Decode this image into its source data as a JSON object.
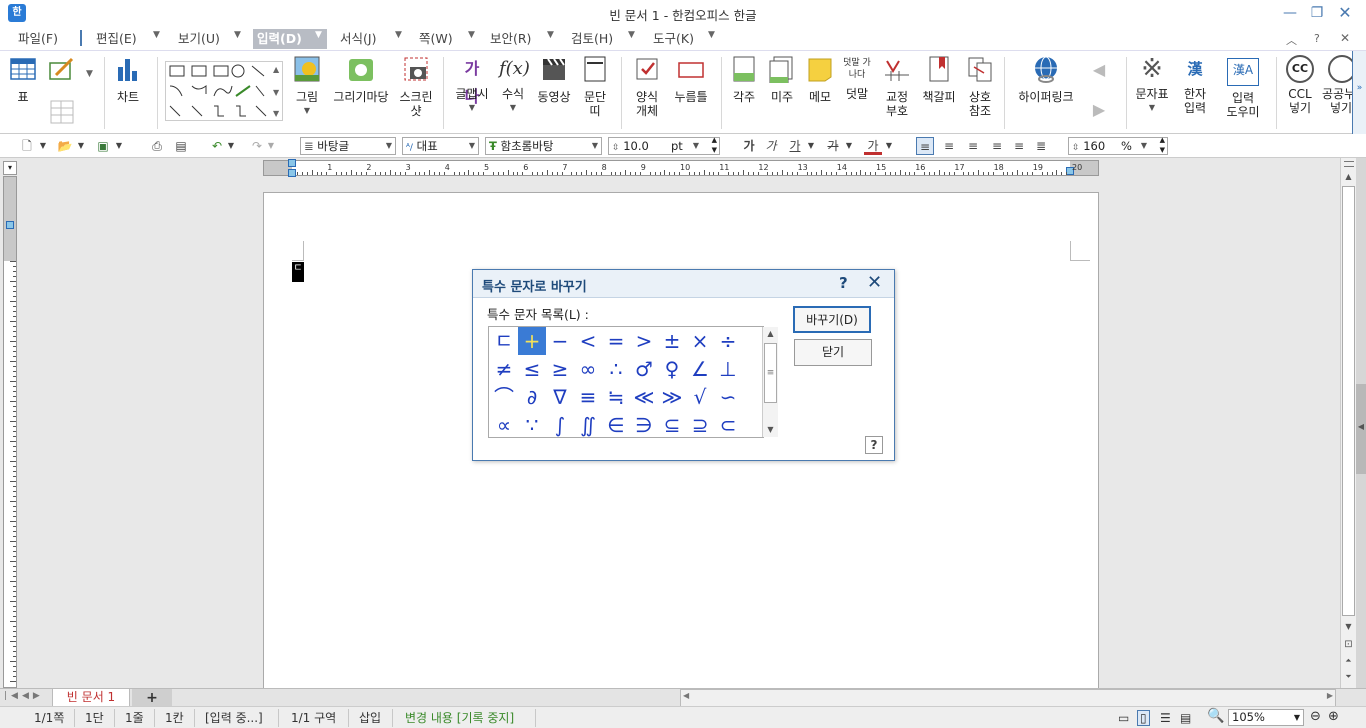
{
  "window": {
    "title": "빈 문서 1 - 한컴오피스 한글"
  },
  "menu": [
    {
      "label": "파일(F)"
    },
    {
      "label": "편집(E)"
    },
    {
      "label": "보기(U)"
    },
    {
      "label": "입력(D)",
      "active": true
    },
    {
      "label": "서식(J)"
    },
    {
      "label": "쪽(W)"
    },
    {
      "label": "보안(R)"
    },
    {
      "label": "검토(H)"
    },
    {
      "label": "도구(K)"
    }
  ],
  "zoom_preset": "24",
  "ribbon": {
    "table": "표",
    "chart": "차트",
    "picture": "그림",
    "gallery": "그리기마당",
    "screenshot_1": "스크린",
    "screenshot_2": "샷",
    "glyph": "글맵시",
    "formula": "수식",
    "video": "동영상",
    "paragraph_1": "문단",
    "paragraph_2": "띠",
    "form_1": "양식",
    "form_2": "개체",
    "pushbutton": "누름틀",
    "footnote": "각주",
    "endnote": "미주",
    "memo": "메모",
    "overlay": "덧말",
    "overlay_icon": "덧말 가나다",
    "proof_1": "교정",
    "proof_2": "부호",
    "bookmark": "책갈피",
    "cross_1": "상호",
    "cross_2": "참조",
    "hyperlink": "하이퍼링크",
    "charmap": "문자표",
    "hanja_1": "한자",
    "hanja_2": "입력",
    "input_help_1": "입력",
    "input_help_2": "도우미",
    "ccl_1": "CCL",
    "ccl_2": "넣기",
    "public_1": "공공누",
    "public_2": "넣기",
    "glyph_icon": "가나",
    "hanja_icon": "漢",
    "input_help_icon": "漢A",
    "ccl_icon": "CC"
  },
  "formatbar": {
    "style": "바탕글",
    "lang": "대표",
    "font": "함초롬바탕",
    "size": "10.0",
    "unit": "pt",
    "bold": "가",
    "italic": "가",
    "underline": "가",
    "strike": "가",
    "color": "가",
    "line_spacing": "160",
    "percent": "%"
  },
  "ruler_ticks": [
    "1",
    "2",
    "3",
    "4",
    "5",
    "6",
    "7",
    "8",
    "9",
    "10",
    "11",
    "12",
    "13",
    "14",
    "15",
    "16",
    "17",
    "18",
    "19",
    "20"
  ],
  "document": {
    "caret_char": "ㄷ"
  },
  "dialog": {
    "title": "특수 문자로 바꾸기",
    "help": "?",
    "close": "✕",
    "list_label": "특수 문자 목록(L) :",
    "symbols": [
      [
        "ㄷ",
        "+",
        "−",
        "<",
        "=",
        ">",
        "±",
        "×",
        "÷"
      ],
      [
        "≠",
        "≤",
        "≥",
        "∞",
        "∴",
        "♂",
        "♀",
        "∠",
        "⊥"
      ],
      [
        "⌒",
        "∂",
        "∇",
        "≡",
        "≒",
        "≪",
        "≫",
        "√",
        "∽"
      ],
      [
        "∝",
        "∵",
        "∫",
        "∬",
        "∈",
        "∋",
        "⊆",
        "⊇",
        "⊂"
      ]
    ],
    "selected": "+",
    "replace_button": "바꾸기(D)",
    "close_button": "닫기",
    "help_button": "?"
  },
  "tabs": {
    "doc_tab": "빈 문서 1",
    "add": "+"
  },
  "status": {
    "page": "1/1쪽",
    "column": "1단",
    "line": "1줄",
    "char": "1칸",
    "input": "[입력 중...]",
    "section": "1/1 구역",
    "insert": "삽입",
    "track": "변경 내용 [기록 중지]",
    "zoom": "105%"
  },
  "colors": {
    "accent": "#2a6bb5",
    "selection": "#3a7bd5",
    "symbol": "#1f3ec0",
    "title_bar": "#eaf1f8"
  }
}
